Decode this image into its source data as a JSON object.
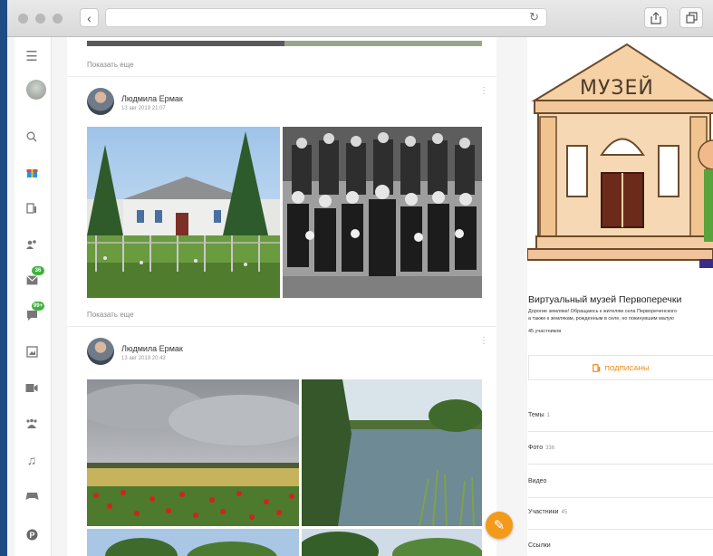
{
  "browser": {
    "back_icon": "chevron-left-icon",
    "reload_icon": "reload-icon",
    "share_icon": "share-icon",
    "tabs_icon": "tabs-icon"
  },
  "feed": {
    "show_more_label": "Показать еще",
    "posts": [
      {
        "author": "Людмила Ермак",
        "date": "13 авг 2019 21:07"
      },
      {
        "author": "Людмила Ермак",
        "date": "13 авг 2019 20:43"
      }
    ]
  },
  "sidebar_badges": {
    "mail": "36",
    "discussions": "99+"
  },
  "group": {
    "logo_text": "МУЗЕЙ",
    "title": "Виртуальный музей Первоперечки",
    "description_line1": "Дорогие земляки! Обращаюсь к жителям села Первореченского",
    "description_line2": "а также к землякам, рожденным в селе, но покинувшим малую",
    "members": "45 участников",
    "subscribe_label": "ПОДПИСАНЫ",
    "menu": [
      {
        "label": "Темы",
        "count": "1"
      },
      {
        "label": "Фото",
        "count": "336"
      },
      {
        "label": "Видео",
        "count": ""
      },
      {
        "label": "Участники",
        "count": "45"
      },
      {
        "label": "Ссылки",
        "count": ""
      }
    ]
  },
  "colors": {
    "accent": "#ee8208",
    "badge": "#3fb33f",
    "background": "#1e4d86"
  }
}
